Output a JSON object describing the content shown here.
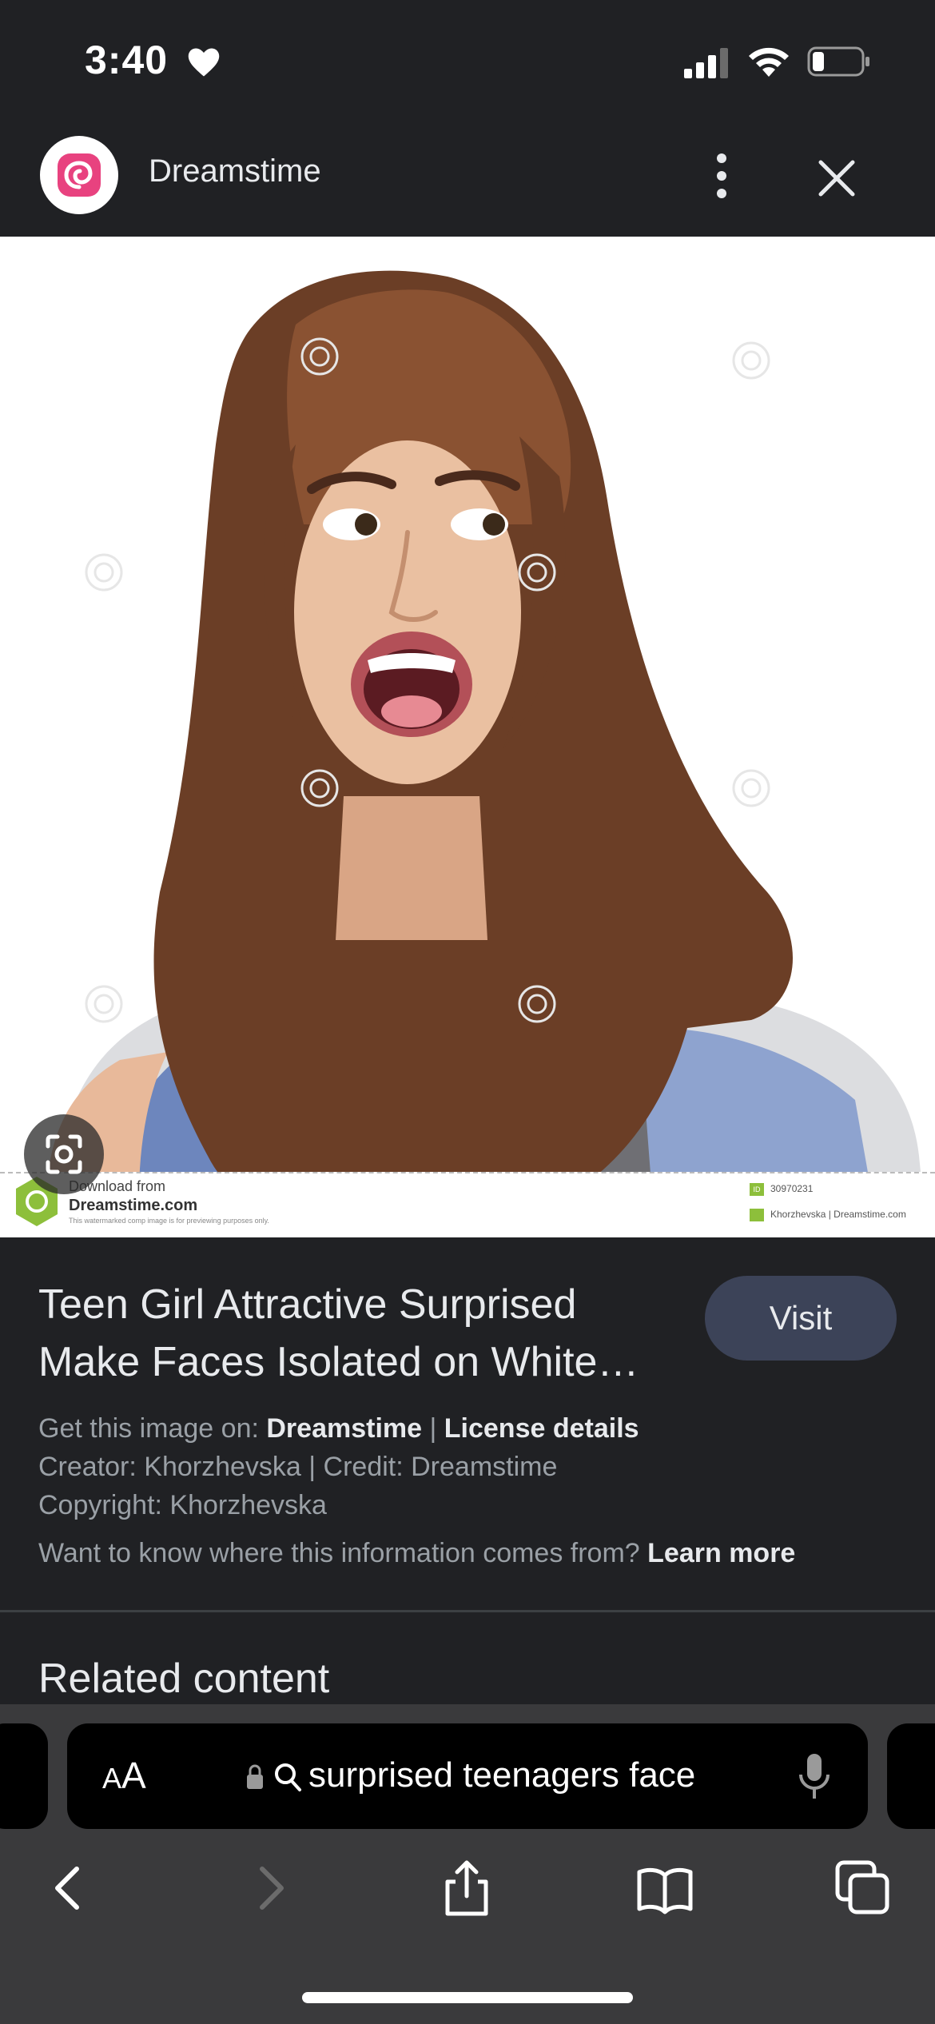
{
  "status_bar": {
    "time": "3:40"
  },
  "header": {
    "site_name": "Dreamstime"
  },
  "image": {
    "watermark_line1": "Download from",
    "watermark_line2": "Dreamstime.com",
    "watermark_line3": "This watermarked comp image is for previewing purposes only.",
    "id_badge": "ID",
    "image_id": "30970231",
    "credit": "Khorzhevska | Dreamstime.com"
  },
  "result": {
    "title": "Teen Girl Attractive Surprised Make Faces Isolated on White…",
    "visit_label": "Visit",
    "get_image_prefix": "Get this image on: ",
    "source_link": "Dreamstime",
    "separator": " | ",
    "license_link": "License details",
    "creator_line": "Creator: Khorzhevska | Credit: Dreamstime",
    "copyright_line": "Copyright: Khorzhevska",
    "info_question": "Want to know where this information comes from? ",
    "learn_more": "Learn more"
  },
  "related": {
    "heading": "Related content"
  },
  "browser": {
    "text_size_big": "A",
    "text_size_small": "A",
    "address_text": "surprised teenagers face"
  },
  "colors": {
    "background": "#202124",
    "visit_button": "#3c4358",
    "toolbar": "#3a3a3c",
    "brand_pink": "#e8427f",
    "brand_green": "#8dbf3b"
  }
}
